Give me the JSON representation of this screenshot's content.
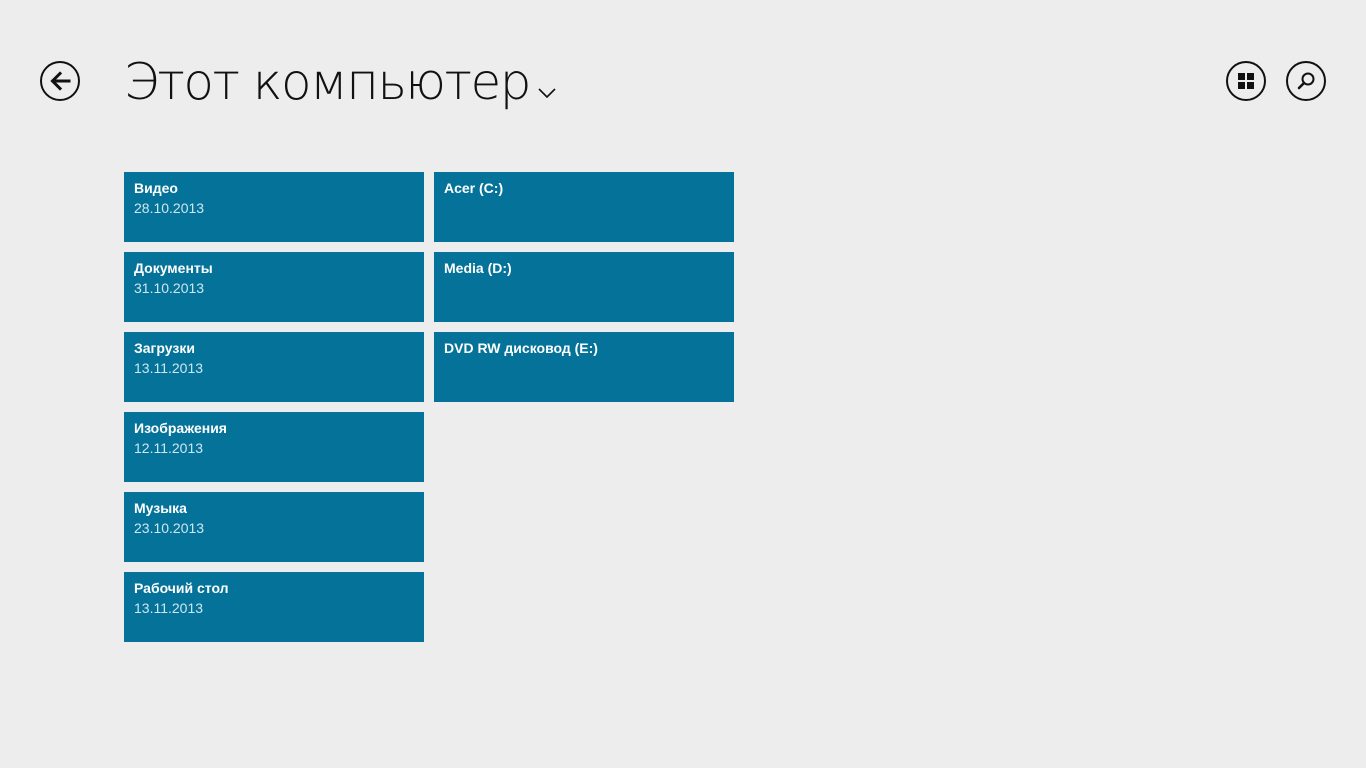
{
  "header": {
    "title": "Этот компьютер",
    "back_icon": "back-arrow-icon",
    "tiles_icon": "tiles-grid-icon",
    "search_icon": "search-icon"
  },
  "colors": {
    "background": "#ededed",
    "tile": "#057399",
    "tile_text": "#ffffff"
  },
  "folders": [
    {
      "name": "Видео",
      "date": "28.10.2013"
    },
    {
      "name": "Документы",
      "date": "31.10.2013"
    },
    {
      "name": "Загрузки",
      "date": "13.11.2013"
    },
    {
      "name": "Изображения",
      "date": "12.11.2013"
    },
    {
      "name": "Музыка",
      "date": "23.10.2013"
    },
    {
      "name": "Рабочий стол",
      "date": "13.11.2013"
    }
  ],
  "drives": [
    {
      "name": "Acer (C:)"
    },
    {
      "name": "Media (D:)"
    },
    {
      "name": "DVD RW дисковод (E:)"
    }
  ]
}
